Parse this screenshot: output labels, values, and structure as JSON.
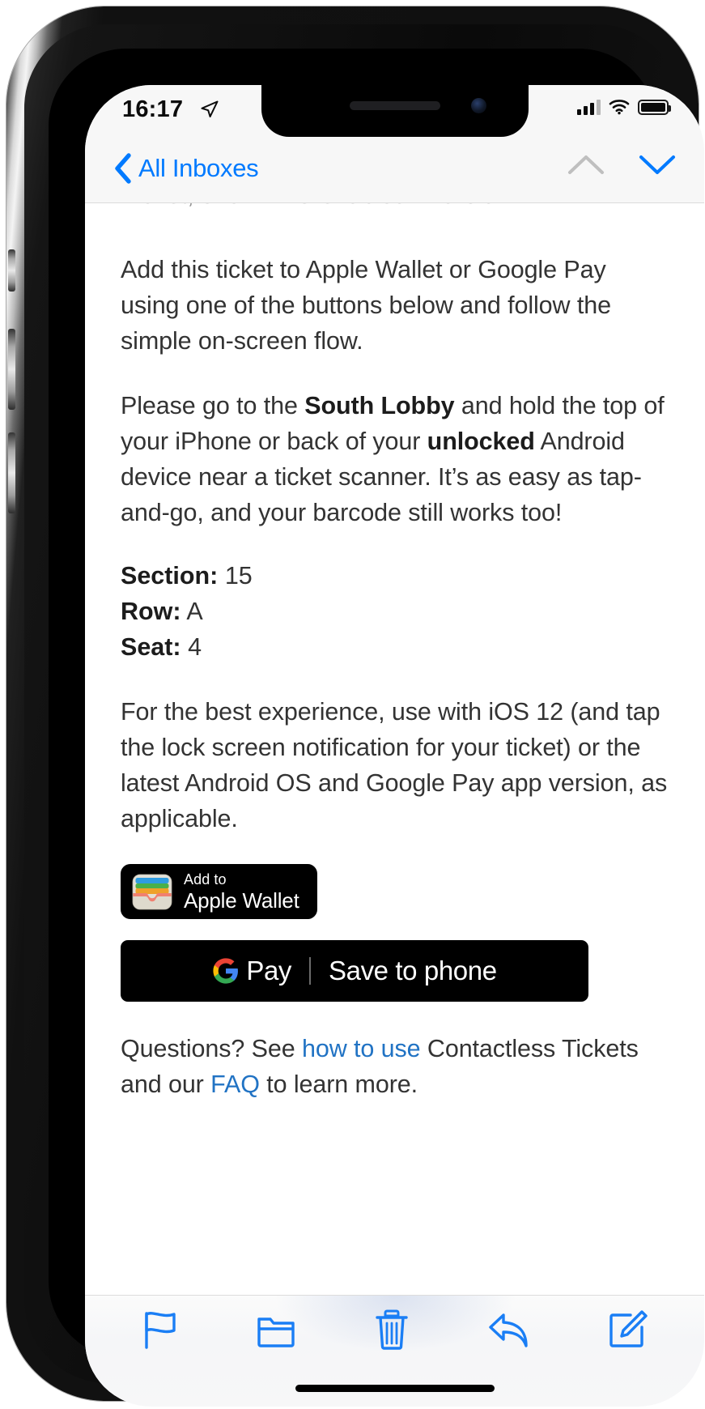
{
  "status_bar": {
    "time": "16:17",
    "location_icon": "location-arrow-icon",
    "signal_icon": "cellular-bars-icon",
    "wifi_icon": "wifi-icon",
    "battery_icon": "battery-full-icon"
  },
  "nav_bar": {
    "back_label": "All Inboxes",
    "back_icon": "chevron-left-icon",
    "prev_message_icon": "chevron-up-icon",
    "next_message_icon": "chevron-down-icon"
  },
  "mail": {
    "clipped_line": "Wallet, or an NFC-enabled Android.",
    "paragraphs": {
      "intro": "Add this ticket to Apple Wallet or Google Pay using one of the buttons below and follow the simple on-screen flow.",
      "instructions_1": "Please go to the ",
      "instructions_bold_1": "South Lobby",
      "instructions_2": " and hold the top of your iPhone or back of your ",
      "instructions_bold_2": "unlocked",
      "instructions_3": " Android device near a ticket scanner. It’s as easy as tap-and-go, and your barcode still works too!",
      "experience": "For the best experience, use with iOS 12 (and tap the lock screen notification for your ticket) or the latest Android OS and Google Pay app version, as applicable."
    },
    "ticket_details": [
      {
        "label": "Section:",
        "value": "15"
      },
      {
        "label": "Row:",
        "value": "A"
      },
      {
        "label": "Seat:",
        "value": "4"
      }
    ],
    "wallet_button": {
      "line1": "Add to",
      "line2": "Apple Wallet",
      "icon": "apple-wallet-icon"
    },
    "gpay_button": {
      "brand": "Pay",
      "action": "Save to phone",
      "icon": "google-g-icon"
    },
    "footer": {
      "before_link1": "Questions? See ",
      "link1": "how to use",
      "between": " Contactless Tickets and our ",
      "link2": "FAQ",
      "after_link2": " to learn more."
    }
  },
  "toolbar": {
    "flag_label": "flag-icon",
    "folder_label": "folder-icon",
    "trash_label": "trash-icon",
    "reply_label": "reply-icon",
    "compose_label": "compose-icon"
  },
  "colors": {
    "accent_blue": "#007aff",
    "link_blue": "#2173c4",
    "toolbar_icon": "#1a7ef5",
    "text": "#333333",
    "button_black": "#000000"
  }
}
